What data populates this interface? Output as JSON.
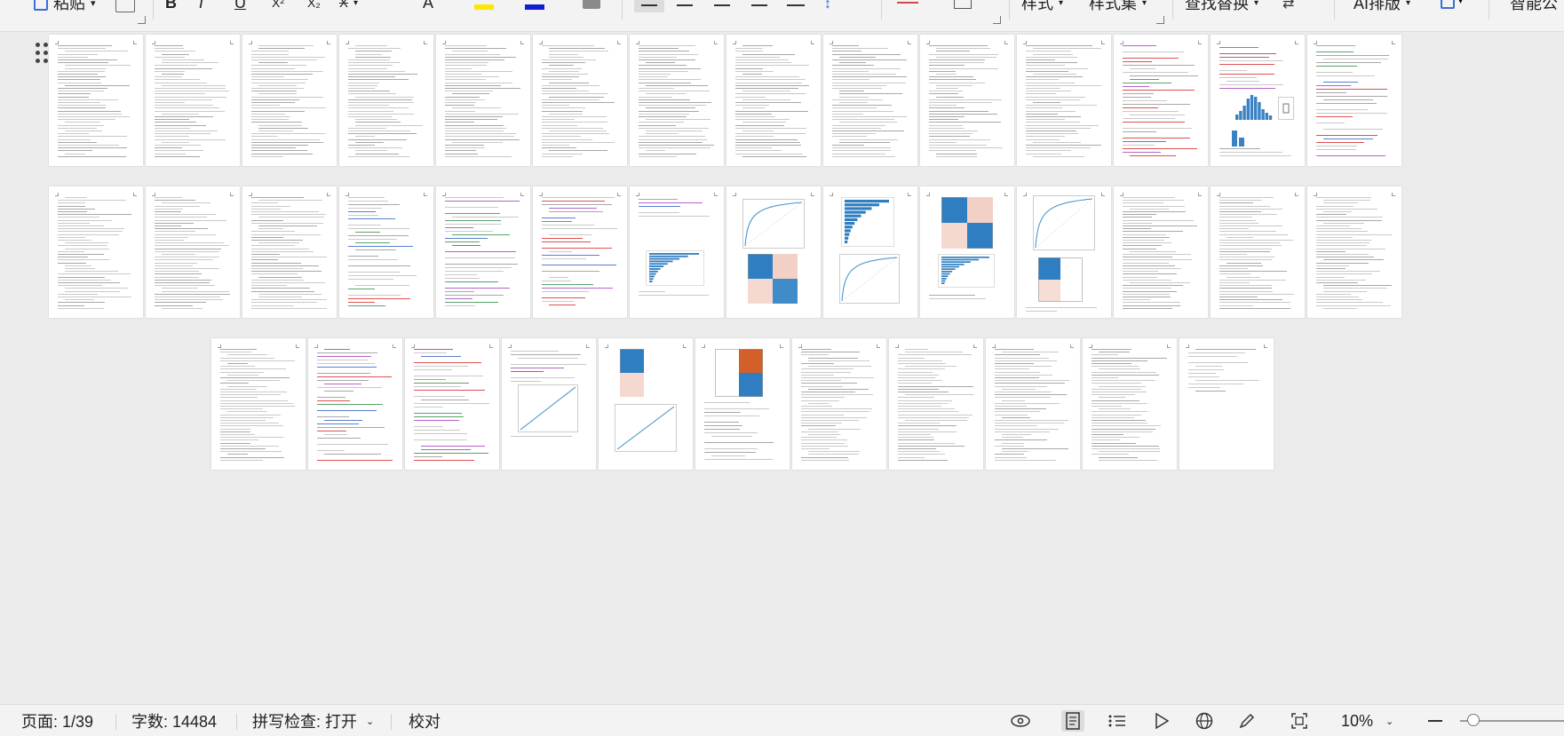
{
  "ribbon": {
    "paste_label": "粘贴",
    "bold_label": "B",
    "italic_label": "I",
    "underline_label": "U",
    "superscript_label": "X²",
    "subscript_label": "X₂",
    "text_effect_label": "A",
    "clear_format_label": "A",
    "style_label": "样式",
    "style_set_label": "样式集",
    "find_replace_label": "查找替换",
    "ai_layout_label": "AI排版",
    "smart_label": "智能公",
    "highlight_color": "#ffe600",
    "font_color": "#1020d0"
  },
  "status": {
    "page": "页面: 1/39",
    "word_count": "字数: 14484",
    "spell_check": "拼写检查: 打开",
    "proofread": "校对",
    "zoom": "10%"
  },
  "document": {
    "page_count": 39,
    "rows": [
      14,
      14,
      11
    ]
  }
}
